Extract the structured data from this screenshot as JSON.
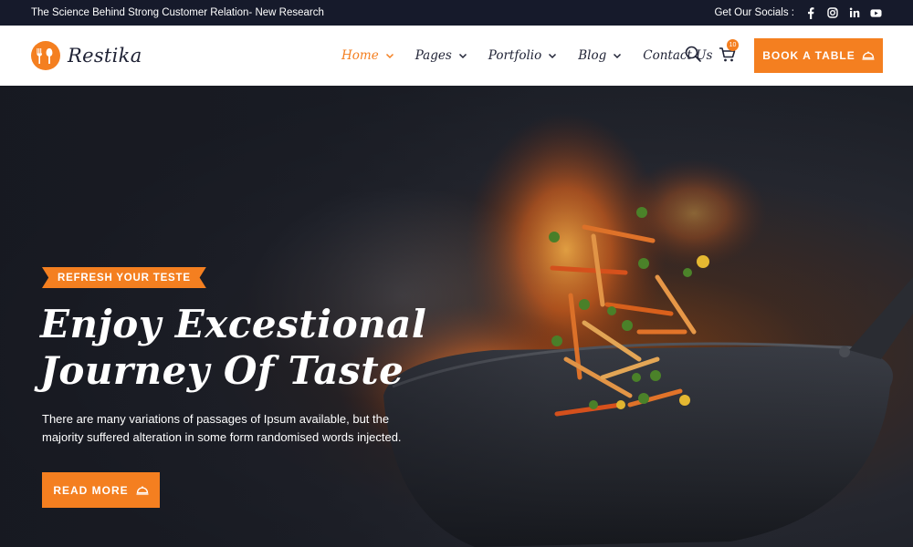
{
  "topbar": {
    "headline": "The Science Behind Strong Customer Relation- New Research",
    "socials_label": "Get Our Socials :",
    "socials": [
      "facebook-icon",
      "instagram-icon",
      "linkedin-icon",
      "youtube-icon"
    ]
  },
  "brand": {
    "name": "Restika",
    "accent": "#f47f20",
    "dark": "#161a2b"
  },
  "nav": {
    "items": [
      {
        "label": "Home",
        "active": true,
        "dropdown": true
      },
      {
        "label": "Pages",
        "active": false,
        "dropdown": true
      },
      {
        "label": "Portfolio",
        "active": false,
        "dropdown": true
      },
      {
        "label": "Blog",
        "active": false,
        "dropdown": true
      },
      {
        "label": "Contact Us",
        "active": false,
        "dropdown": false
      }
    ],
    "cart_count": "10",
    "book_label": "BOOK A TABLE"
  },
  "hero": {
    "tag": "REFRESH YOUR TESTE",
    "title_line1": "Enjoy Excestional",
    "title_line2": "Journey Of Taste",
    "description": "There are many variations of passages of Ipsum available, but the majority suffered alteration in some form randomised words injected.",
    "cta_label": "READ MORE"
  }
}
